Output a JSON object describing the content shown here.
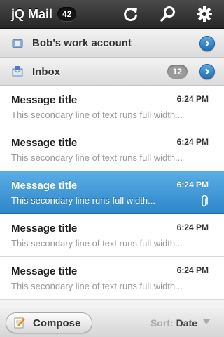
{
  "header": {
    "title": "jQ Mail",
    "count": "42",
    "icons": [
      "refresh-icon",
      "search-icon",
      "gear-icon"
    ]
  },
  "account": {
    "label": "Bob’s work account",
    "icon": "account-icon"
  },
  "inbox": {
    "label": "Inbox",
    "count": "12",
    "icon": "inbox-icon"
  },
  "messages": [
    {
      "title": "Message title",
      "time": "6:24 PM",
      "preview": "This secondary line of text runs full width..."
    },
    {
      "title": "Message title",
      "time": "6:24 PM",
      "preview": "This secondary line of text runs full width..."
    },
    {
      "title": "Message title",
      "time": "6:24 PM",
      "preview": "This secondary line runs full width...",
      "selected": true,
      "attachment": true
    },
    {
      "title": "Message title",
      "time": "6:24 PM",
      "preview": "This secondary line of text runs full width..."
    },
    {
      "title": "Message title",
      "time": "6:24 PM",
      "preview": "This secondary line of text runs full width..."
    }
  ],
  "footer": {
    "compose_label": "Compose",
    "sort_label": "Sort:",
    "sort_value": "Date"
  },
  "colors": {
    "accent": "#2d86c8",
    "header": "#262626"
  }
}
